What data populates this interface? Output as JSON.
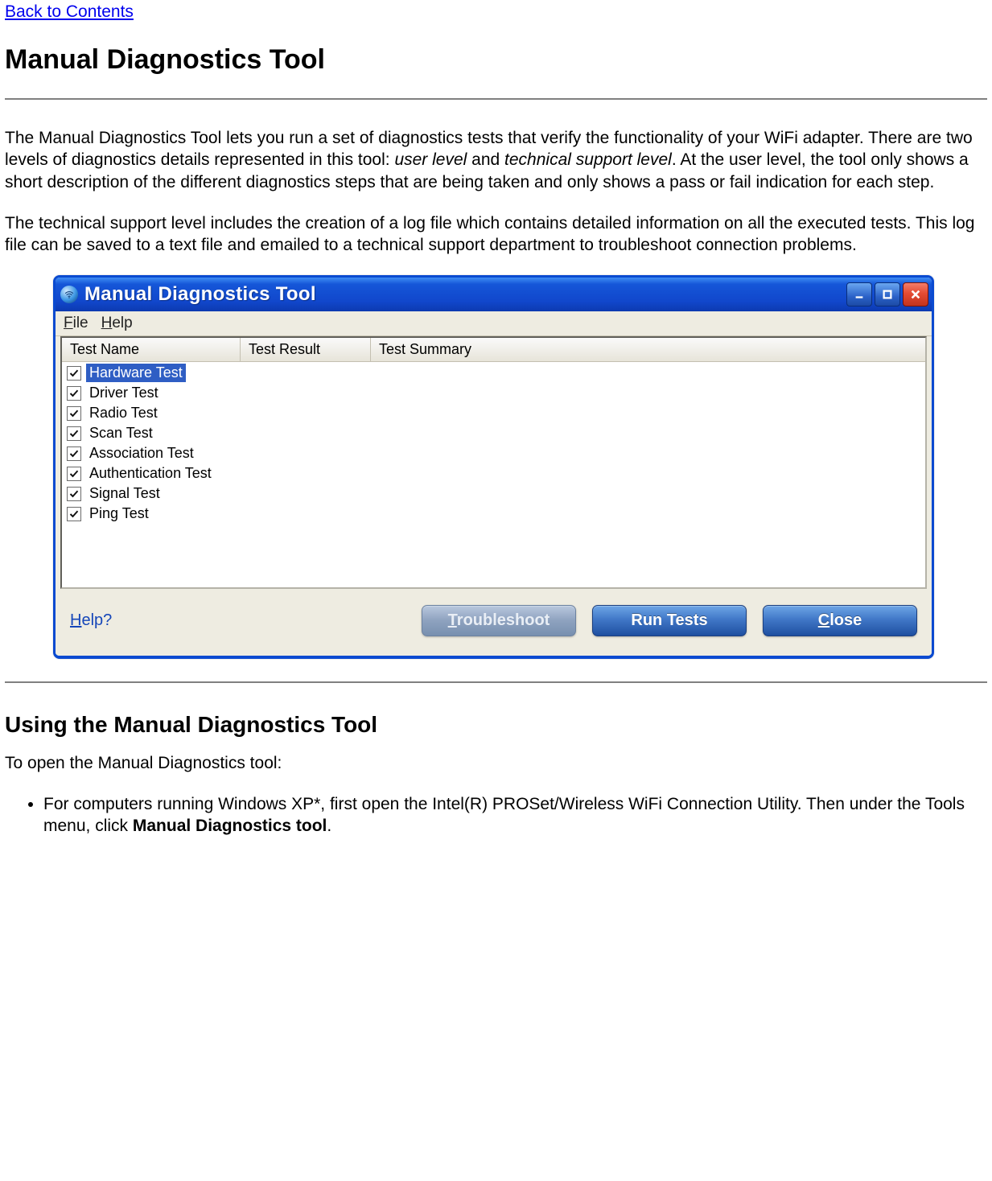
{
  "nav": {
    "back_link": "Back to Contents"
  },
  "headings": {
    "h1": "Manual Diagnostics Tool",
    "h2": "Using the Manual Diagnostics Tool"
  },
  "paragraphs": {
    "p1_a": "The Manual Diagnostics Tool lets you run a set of diagnostics tests that verify the functionality of your WiFi adapter. There are two levels of diagnostics details represented in this tool: ",
    "p1_i1": "user level",
    "p1_b": " and ",
    "p1_i2": "technical support level",
    "p1_c": ". At the user level, the tool only shows a short description of the different diagnostics steps that are being taken and only shows a pass or fail indication for each step.",
    "p2": "The technical support level includes the creation of a log file which contains detailed information on all the executed tests. This log file can be saved to a text file and emailed to a technical support department to troubleshoot connection problems.",
    "p3": "To open the Manual Diagnostics tool:",
    "bullet1_a": "For computers running Windows XP*, first open the Intel(R) PROSet/Wireless WiFi Connection Utility. Then under the Tools menu, click ",
    "bullet1_bold": "Manual Diagnostics tool",
    "bullet1_b": "."
  },
  "window": {
    "title": "Manual Diagnostics Tool",
    "menus": {
      "file": "File",
      "help": "Help",
      "file_ul": "F",
      "help_ul": "H"
    },
    "columns": {
      "name": "Test Name",
      "result": "Test Result",
      "summary": "Test Summary"
    },
    "tests": [
      {
        "label": "Hardware Test",
        "checked": true,
        "selected": true
      },
      {
        "label": "Driver Test",
        "checked": true,
        "selected": false
      },
      {
        "label": "Radio Test",
        "checked": true,
        "selected": false
      },
      {
        "label": "Scan Test",
        "checked": true,
        "selected": false
      },
      {
        "label": "Association Test",
        "checked": true,
        "selected": false
      },
      {
        "label": "Authentication Test",
        "checked": true,
        "selected": false
      },
      {
        "label": "Signal Test",
        "checked": true,
        "selected": false
      },
      {
        "label": "Ping Test",
        "checked": true,
        "selected": false
      }
    ],
    "help_link": "Help?",
    "help_ul": "H",
    "buttons": {
      "troubleshoot": "Troubleshoot",
      "troubleshoot_ul": "T",
      "run": "Run Tests",
      "close": "Close",
      "close_ul": "C"
    }
  }
}
